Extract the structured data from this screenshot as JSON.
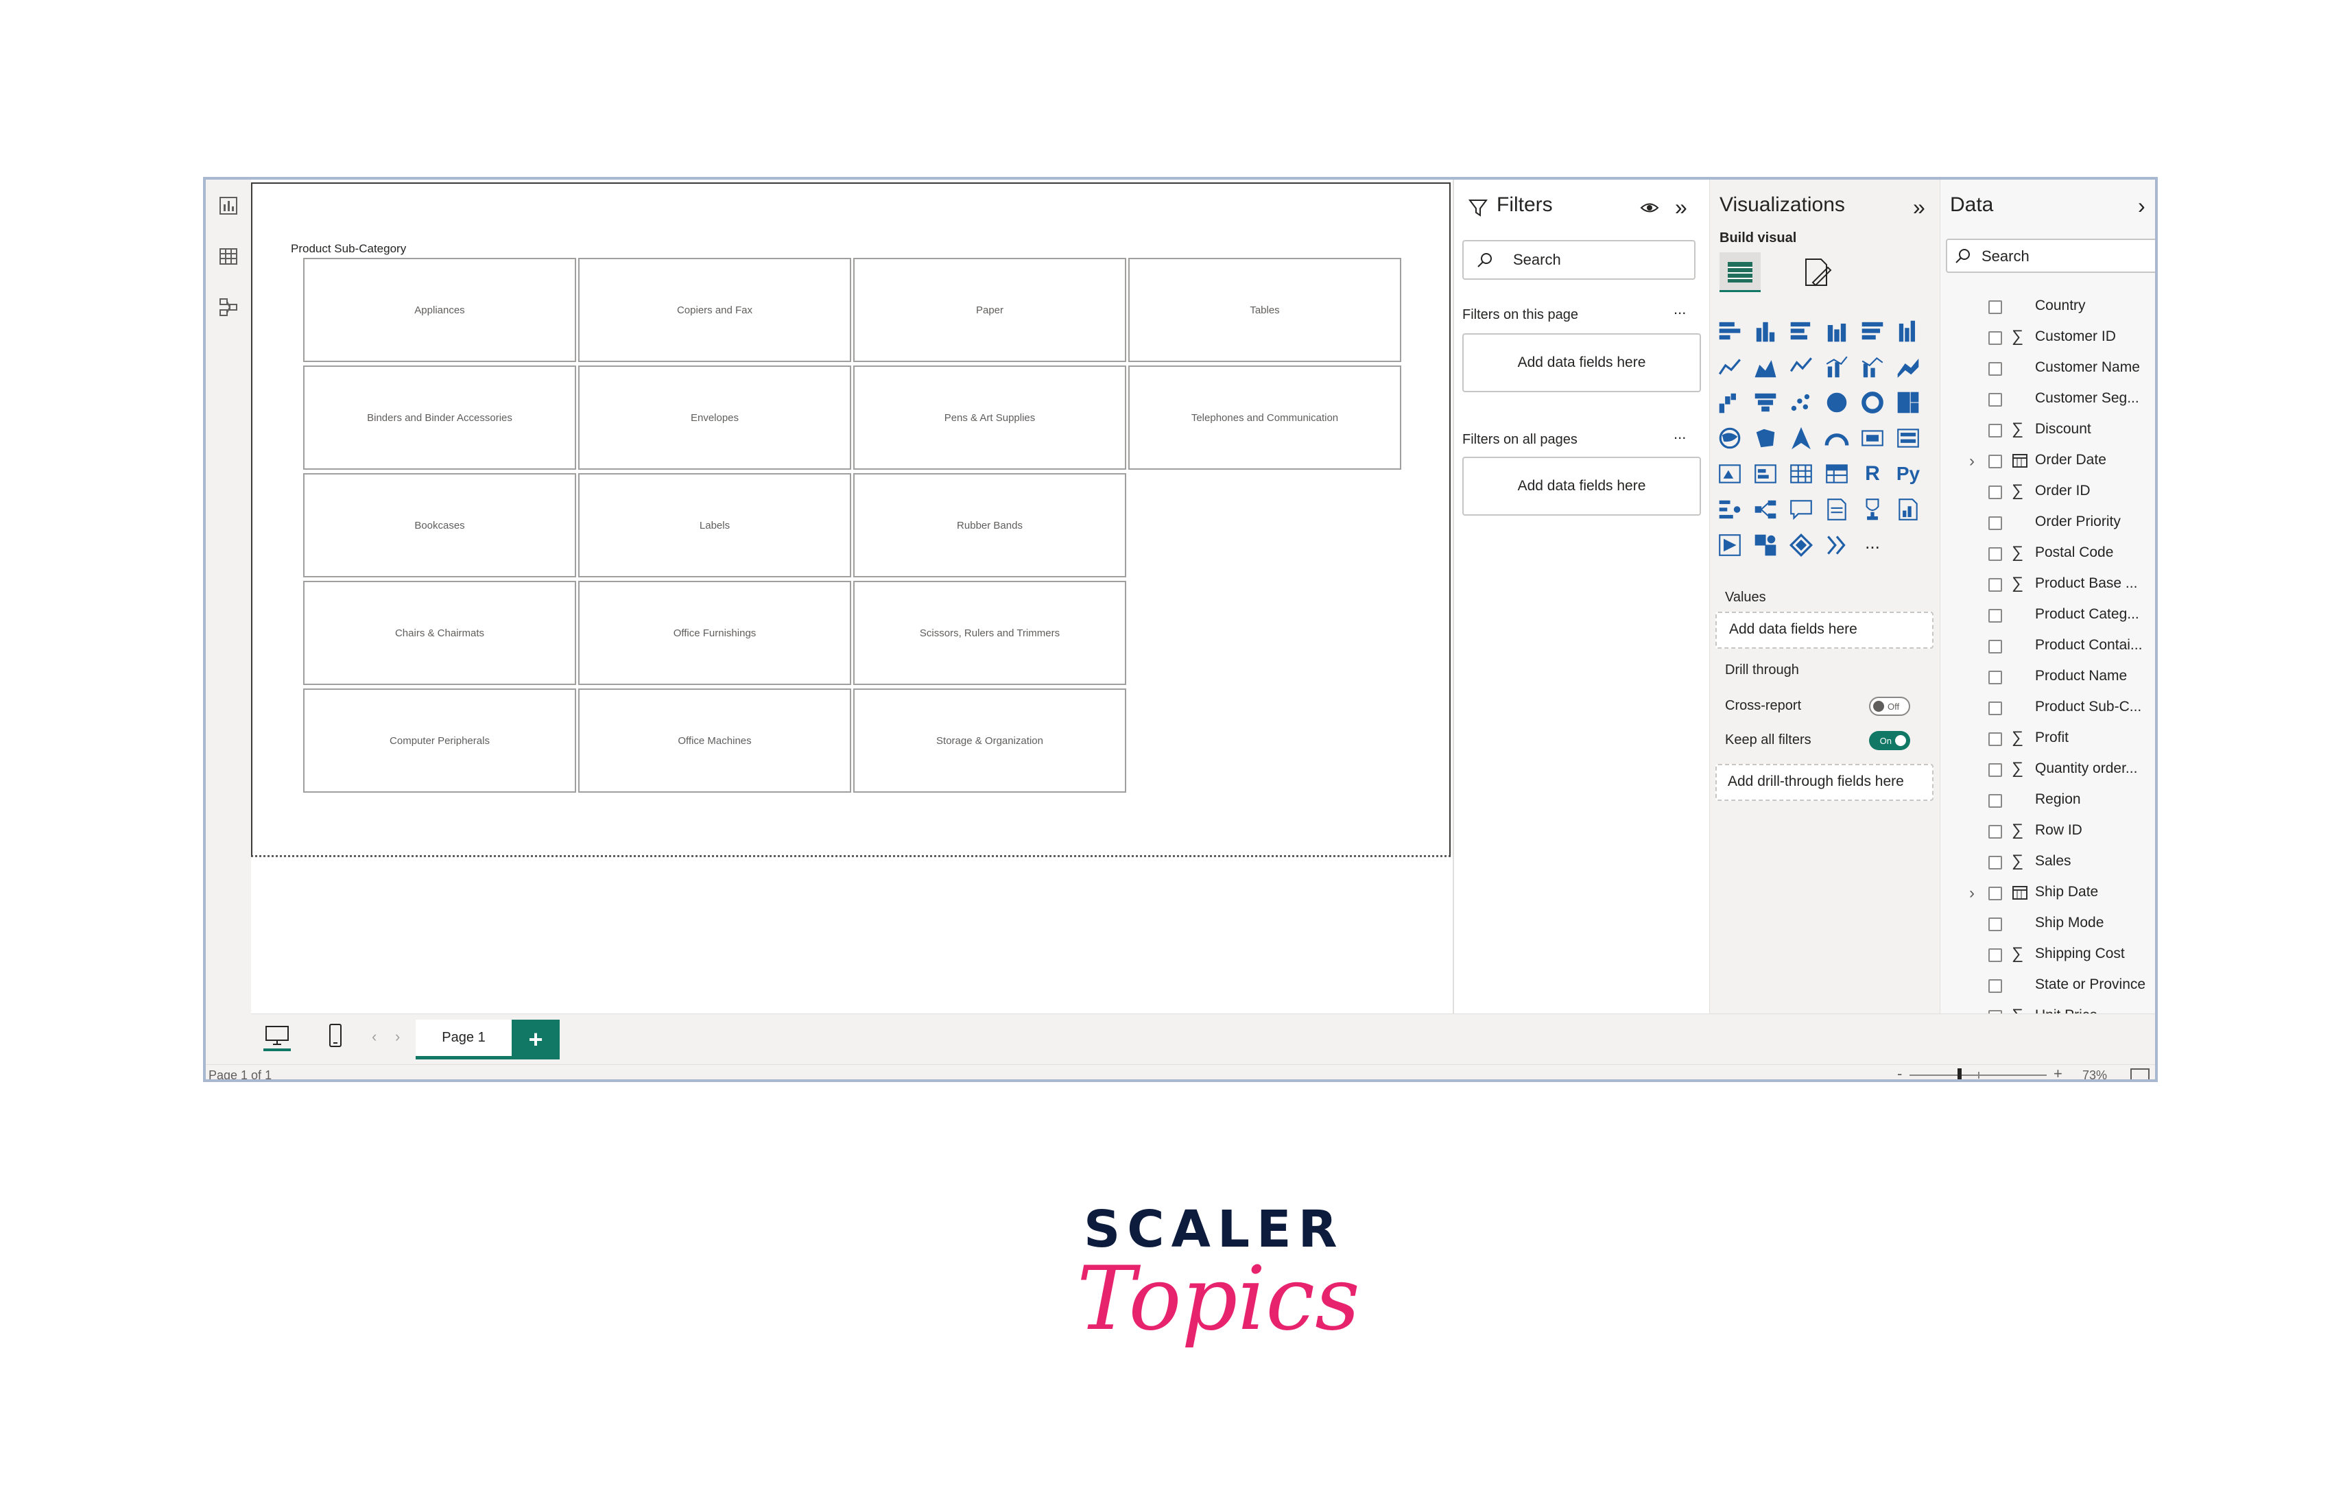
{
  "canvas": {
    "slicer_title": "Product Sub-Category",
    "tiles": [
      [
        "Appliances",
        "Copiers and Fax",
        "Paper",
        "Tables"
      ],
      [
        "Binders and Binder Accessories",
        "Envelopes",
        "Pens & Art Supplies",
        "Telephones and Communication"
      ],
      [
        "Bookcases",
        "Labels",
        "Rubber Bands"
      ],
      [
        "Chairs & Chairmats",
        "Office Furnishings",
        "Scissors, Rulers and Trimmers"
      ],
      [
        "Computer Peripherals",
        "Office Machines",
        "Storage & Organization"
      ]
    ]
  },
  "tabs": {
    "page1": "Page 1",
    "add": "+"
  },
  "status": {
    "page_count": "Page 1 of 1",
    "zoom": "73%"
  },
  "filters": {
    "title": "Filters",
    "search_placeholder": "Search",
    "on_this_page": "Filters on this page",
    "on_all_pages": "Filters on all pages",
    "add_fields": "Add data fields here",
    "more": "..."
  },
  "visualizations": {
    "title": "Visualizations",
    "build_visual": "Build visual",
    "values": "Values",
    "values_add": "Add data fields here",
    "drill_through": "Drill through",
    "cross_report": "Cross-report",
    "cross_report_state": "Off",
    "keep_all_filters": "Keep all filters",
    "keep_all_filters_state": "On",
    "drill_add": "Add drill-through fields here",
    "r_label": "R",
    "py_label": "Py",
    "more": "..."
  },
  "data_pane": {
    "title": "Data",
    "search_placeholder": "Search",
    "fields": [
      {
        "name": "Country",
        "type": "text"
      },
      {
        "name": "Customer ID",
        "type": "sum"
      },
      {
        "name": "Customer Name",
        "type": "text"
      },
      {
        "name": "Customer Seg...",
        "type": "text"
      },
      {
        "name": "Discount",
        "type": "sum"
      },
      {
        "name": "Order Date",
        "type": "date"
      },
      {
        "name": "Order ID",
        "type": "sum"
      },
      {
        "name": "Order Priority",
        "type": "text"
      },
      {
        "name": "Postal Code",
        "type": "sum"
      },
      {
        "name": "Product Base ...",
        "type": "sum"
      },
      {
        "name": "Product Categ...",
        "type": "text"
      },
      {
        "name": "Product Contai...",
        "type": "text"
      },
      {
        "name": "Product Name",
        "type": "text"
      },
      {
        "name": "Product Sub-C...",
        "type": "text"
      },
      {
        "name": "Profit",
        "type": "sum"
      },
      {
        "name": "Quantity order...",
        "type": "sum"
      },
      {
        "name": "Region",
        "type": "text"
      },
      {
        "name": "Row ID",
        "type": "sum"
      },
      {
        "name": "Sales",
        "type": "sum"
      },
      {
        "name": "Ship Date",
        "type": "date"
      },
      {
        "name": "Ship Mode",
        "type": "text"
      },
      {
        "name": "Shipping Cost",
        "type": "sum"
      },
      {
        "name": "State or Province",
        "type": "text"
      },
      {
        "name": "Unit Price",
        "type": "sum"
      }
    ]
  },
  "logo": {
    "word": "SCALER",
    "script": "Topics"
  },
  "colors": {
    "accent": "#117865",
    "brand_navy": "#0d1b3d",
    "brand_pink": "#e8236e"
  }
}
